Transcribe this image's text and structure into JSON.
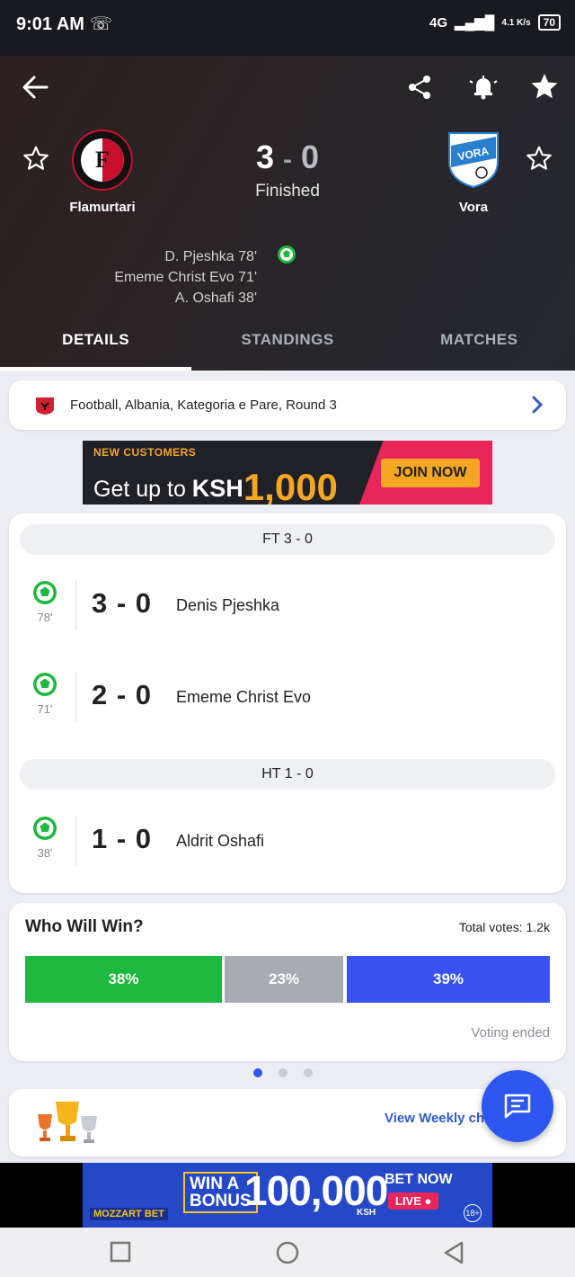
{
  "status_bar": {
    "time": "9:01 AM",
    "network": "4G",
    "speed": "4.1 K/s",
    "battery": "70"
  },
  "header": {
    "home_team": "Flamurtari",
    "away_team": "Vora",
    "home_score": "3",
    "score_separator": "-",
    "away_score": "0",
    "match_status": "Finished",
    "scorers": [
      "D. Pjeshka 78'",
      "Ememe Christ Evo 71'",
      "A. Oshafi 38'"
    ],
    "home_crest_text": "FLAMURTARI",
    "away_crest_text": "VORA"
  },
  "tabs": [
    {
      "label": "DETAILS",
      "active": true
    },
    {
      "label": "STANDINGS",
      "active": false
    },
    {
      "label": "MATCHES",
      "active": false
    }
  ],
  "competition": {
    "label": "Football, Albania, Kategoria e Pare, Round 3"
  },
  "ad_top": {
    "tagline": "NEW CUSTOMERS",
    "text": "Get up to ",
    "currency": "KSH",
    "amount": "1,000",
    "cta": "JOIN NOW"
  },
  "events": {
    "fulltime_label": "FT 3 - 0",
    "halftime_label": "HT 1 - 0",
    "goals": [
      {
        "minute": "78'",
        "score": "3 - 0",
        "player": "Denis Pjeshka"
      },
      {
        "minute": "71'",
        "score": "2 - 0",
        "player": "Ememe Christ Evo"
      },
      {
        "minute": "38'",
        "score": "1 - 0",
        "player": "Aldrit Oshafi"
      }
    ]
  },
  "vote": {
    "title": "Who Will Win?",
    "total": "Total votes: 1.2k",
    "home_pct": "38%",
    "draw_pct": "23%",
    "away_pct": "39%",
    "status": "Voting ended",
    "colors": {
      "home": "#1db83e",
      "draw": "#a8abb2",
      "away": "#3a52f2"
    }
  },
  "carousel": {
    "pages": 3,
    "active": 1
  },
  "weekly": {
    "link": "View Weekly cha"
  },
  "ad_bottom": {
    "brand": "MOZZART BET",
    "win_line1": "WIN A",
    "win_line2": "BONUS",
    "amount": "100,000",
    "currency": "KSH",
    "bet_now": "BET NOW",
    "live": "LIVE ●",
    "age": "18+"
  },
  "colors": {
    "accent": "#2e56f0",
    "goal_green": "#1db83e"
  }
}
